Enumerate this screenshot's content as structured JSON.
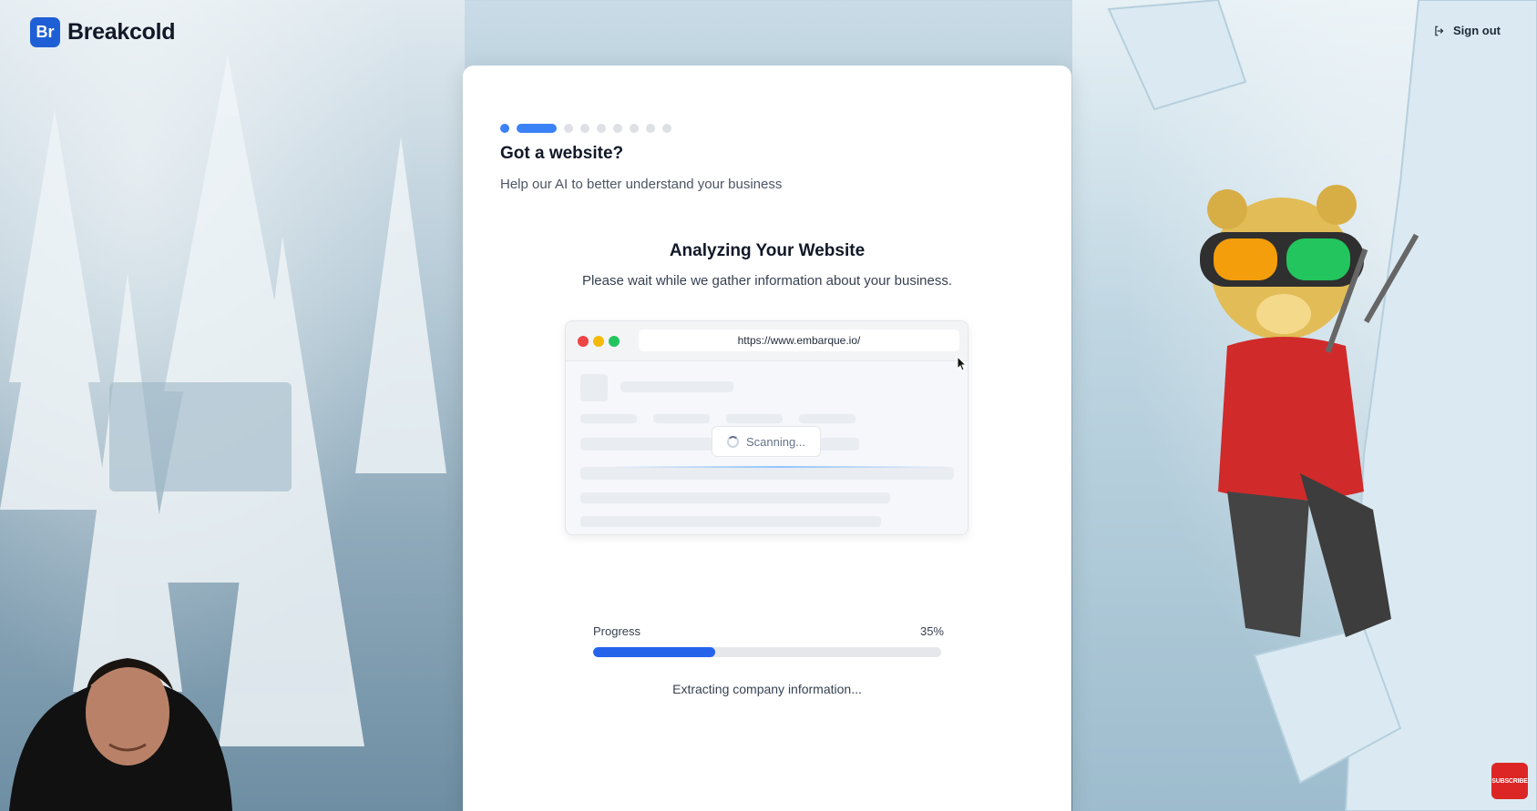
{
  "header": {
    "logo_badge": "Br",
    "logo_text": "Breakcold",
    "signout_label": "Sign out"
  },
  "onboarding": {
    "steps_total": 10,
    "current_step": 2,
    "title": "Got a website?",
    "subtitle": "Help our AI to better understand your business"
  },
  "analysis": {
    "title": "Analyzing Your Website",
    "subtitle": "Please wait while we gather information about your business.",
    "browser_url": "https://www.embarque.io/",
    "scanning_label": "Scanning...",
    "progress_label": "Progress",
    "progress_value_text": "35%",
    "progress_percent": 35,
    "status_text": "Extracting company information..."
  },
  "overlay": {
    "subscribe_label": "SUBSCRIBE"
  },
  "colors": {
    "brand": "#1f5fd6",
    "progress": "#2563eb",
    "step_active": "#3b82f6",
    "step_inactive": "#dde1e6"
  }
}
